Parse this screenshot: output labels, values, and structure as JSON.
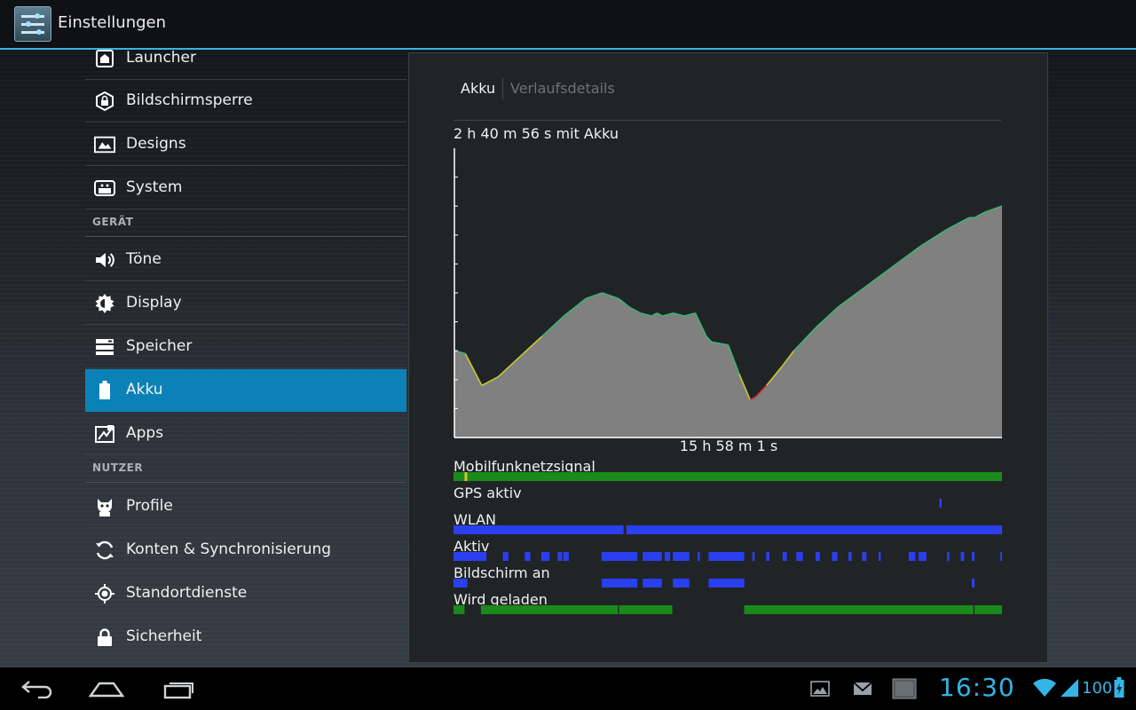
{
  "app": {
    "title": "Einstellungen"
  },
  "sidebar": {
    "items": [
      {
        "label": "Launcher",
        "icon": "launcher-icon"
      },
      {
        "label": "Bildschirmsperre",
        "icon": "lock-screen-icon"
      },
      {
        "label": "Designs",
        "icon": "themes-icon"
      },
      {
        "label": "System",
        "icon": "system-icon"
      },
      {
        "label": "Töne",
        "icon": "sound-icon"
      },
      {
        "label": "Display",
        "icon": "display-icon"
      },
      {
        "label": "Speicher",
        "icon": "storage-icon"
      },
      {
        "label": "Akku",
        "icon": "battery-icon",
        "selected": true
      },
      {
        "label": "Apps",
        "icon": "apps-icon"
      },
      {
        "label": "Profile",
        "icon": "profiles-icon"
      },
      {
        "label": "Konten & Synchronisierung",
        "icon": "sync-icon"
      },
      {
        "label": "Standortdienste",
        "icon": "location-icon"
      },
      {
        "label": "Sicherheit",
        "icon": "security-lock-icon"
      }
    ],
    "sections": {
      "device": "GERÄT",
      "user": "NUTZER"
    }
  },
  "panel": {
    "tabs": {
      "active": "Akku",
      "inactive": "Verlaufsdetails"
    },
    "on_battery": "2 h 40 m 56 s mit Akku",
    "timespan": "15 h 58 m 1 s",
    "tracks": {
      "signal": "Mobilfunknetzsignal",
      "gps": "GPS aktiv",
      "wifi": "WLAN",
      "awake": "Aktiv",
      "screen": "Bildschirm an",
      "charging": "Wird geladen"
    }
  },
  "chart_data": {
    "type": "area",
    "title": "",
    "xlabel": "",
    "ylabel": "",
    "x_fraction": [
      0,
      0.02,
      0.05,
      0.08,
      0.12,
      0.16,
      0.2,
      0.24,
      0.27,
      0.3,
      0.32,
      0.34,
      0.36,
      0.37,
      0.38,
      0.4,
      0.42,
      0.44,
      0.46,
      0.47,
      0.5,
      0.52,
      0.54,
      0.55,
      0.57,
      0.6,
      0.62,
      0.66,
      0.7,
      0.75,
      0.8,
      0.85,
      0.9,
      0.94,
      0.95,
      0.97,
      1.0
    ],
    "level_fraction": [
      0.3,
      0.29,
      0.18,
      0.21,
      0.28,
      0.35,
      0.42,
      0.48,
      0.5,
      0.48,
      0.45,
      0.43,
      0.42,
      0.43,
      0.42,
      0.43,
      0.42,
      0.43,
      0.35,
      0.33,
      0.32,
      0.22,
      0.13,
      0.14,
      0.18,
      0.25,
      0.3,
      0.38,
      0.45,
      0.52,
      0.59,
      0.66,
      0.72,
      0.76,
      0.76,
      0.78,
      0.8
    ],
    "grid": false,
    "colors": {
      "fill": "#808080",
      "line_good": "#3cb371",
      "line_mid": "#c8c832",
      "line_low": "#d03030"
    }
  },
  "tracks_data": {
    "signal": [
      [
        0.0,
        0.3,
        "#1a8a1a"
      ],
      [
        0.02,
        0.005,
        "#c8c832"
      ],
      [
        0.3,
        0.01,
        "#c8c832"
      ],
      [
        0.31,
        0.005,
        "#c8c832"
      ],
      [
        0.4,
        0.005,
        "#c8c832"
      ],
      [
        0.47,
        0.01,
        "#888888"
      ],
      [
        0.5,
        0.005,
        "#c8c832"
      ],
      [
        0.3,
        0.7,
        "#1a8a1a"
      ]
    ],
    "gps": [
      [
        0.886,
        0.004,
        "#2a3ff0"
      ]
    ],
    "wifi": [
      [
        0.0,
        0.31,
        "#2a3ff0"
      ],
      [
        0.315,
        0.685,
        "#2a3ff0"
      ]
    ],
    "awake": [
      [
        0.0,
        0.06,
        "#2a3ff0"
      ],
      [
        0.09,
        0.01,
        "#2a3ff0"
      ],
      [
        0.13,
        0.01,
        "#2a3ff0"
      ],
      [
        0.16,
        0.015,
        "#2a3ff0"
      ],
      [
        0.19,
        0.008,
        "#2a3ff0"
      ],
      [
        0.2,
        0.01,
        "#2a3ff0"
      ],
      [
        0.27,
        0.065,
        "#2a3ff0"
      ],
      [
        0.345,
        0.035,
        "#2a3ff0"
      ],
      [
        0.385,
        0.01,
        "#2a3ff0"
      ],
      [
        0.4,
        0.03,
        "#2a3ff0"
      ],
      [
        0.445,
        0.004,
        "#2a3ff0"
      ],
      [
        0.465,
        0.065,
        "#2a3ff0"
      ],
      [
        0.545,
        0.004,
        "#2a3ff0"
      ],
      [
        0.57,
        0.006,
        "#2a3ff0"
      ],
      [
        0.6,
        0.008,
        "#2a3ff0"
      ],
      [
        0.625,
        0.012,
        "#2a3ff0"
      ],
      [
        0.66,
        0.008,
        "#2a3ff0"
      ],
      [
        0.69,
        0.01,
        "#2a3ff0"
      ],
      [
        0.72,
        0.006,
        "#2a3ff0"
      ],
      [
        0.745,
        0.008,
        "#2a3ff0"
      ],
      [
        0.775,
        0.004,
        "#2a3ff0"
      ],
      [
        0.83,
        0.012,
        "#2a3ff0"
      ],
      [
        0.848,
        0.014,
        "#2a3ff0"
      ],
      [
        0.9,
        0.004,
        "#2a3ff0"
      ],
      [
        0.925,
        0.006,
        "#2a3ff0"
      ],
      [
        0.945,
        0.005,
        "#2a3ff0"
      ],
      [
        0.997,
        0.003,
        "#2a3ff0"
      ]
    ],
    "screen": [
      [
        0.0,
        0.025,
        "#2a3ff0"
      ],
      [
        0.27,
        0.065,
        "#2a3ff0"
      ],
      [
        0.345,
        0.035,
        "#2a3ff0"
      ],
      [
        0.4,
        0.03,
        "#2a3ff0"
      ],
      [
        0.465,
        0.065,
        "#2a3ff0"
      ],
      [
        0.945,
        0.005,
        "#2a3ff0"
      ]
    ],
    "charging": [
      [
        0.0,
        0.02,
        "#1a8a1a"
      ],
      [
        0.05,
        0.25,
        "#1a8a1a"
      ],
      [
        0.302,
        0.097,
        "#1a8a1a"
      ],
      [
        0.53,
        0.418,
        "#1a8a1a"
      ],
      [
        0.95,
        0.05,
        "#1a8a1a"
      ]
    ]
  },
  "status": {
    "clock": "16:30",
    "battery": "100"
  },
  "nav": {
    "back": "back-icon",
    "home": "home-icon",
    "recents": "recents-icon"
  },
  "notifications": [
    "gallery-icon",
    "gmail-icon",
    "screenshot-icon"
  ]
}
